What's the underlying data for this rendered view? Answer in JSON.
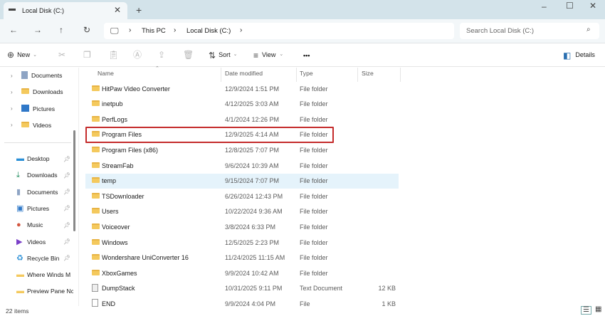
{
  "window": {
    "tab_title": "Local Disk (C:)"
  },
  "nav": {
    "breadcrumb": [
      "This PC",
      "Local Disk (C:)"
    ],
    "search_placeholder": "Search Local Disk (C:)"
  },
  "toolbar": {
    "new_label": "New",
    "sort_label": "Sort",
    "view_label": "View",
    "more_label": "•••",
    "details_label": "Details"
  },
  "sidebar": {
    "top": [
      {
        "label": "Documents",
        "icon": "documents-icon"
      },
      {
        "label": "Downloads",
        "icon": "folder-icon"
      },
      {
        "label": "Pictures",
        "icon": "pictures-icon"
      },
      {
        "label": "Videos",
        "icon": "folder-icon"
      }
    ],
    "quick": [
      {
        "label": "Desktop",
        "pinned": true
      },
      {
        "label": "Downloads",
        "pinned": true
      },
      {
        "label": "Documents",
        "pinned": true
      },
      {
        "label": "Pictures",
        "pinned": true
      },
      {
        "label": "Music",
        "pinned": true
      },
      {
        "label": "Videos",
        "pinned": true
      },
      {
        "label": "Recycle Bin",
        "pinned": true
      },
      {
        "label": "Where Winds M",
        "pinned": false
      },
      {
        "label": "Preview Pane Nc",
        "pinned": false
      }
    ]
  },
  "columns": {
    "name": "Name",
    "date": "Date modified",
    "type": "Type",
    "size": "Size"
  },
  "files": [
    {
      "name": "HitPaw Video Converter",
      "date": "12/9/2024 1:51 PM",
      "type": "File folder",
      "size": ""
    },
    {
      "name": "inetpub",
      "date": "4/12/2025 3:03 AM",
      "type": "File folder",
      "size": ""
    },
    {
      "name": "PerfLogs",
      "date": "4/1/2024 12:26 PM",
      "type": "File folder",
      "size": ""
    },
    {
      "name": "Program Files",
      "date": "12/9/2025 4:14 AM",
      "type": "File folder",
      "size": "",
      "highlighted": true
    },
    {
      "name": "Program Files (x86)",
      "date": "12/8/2025 7:07 PM",
      "type": "File folder",
      "size": ""
    },
    {
      "name": "StreamFab",
      "date": "9/6/2024 10:39 AM",
      "type": "File folder",
      "size": ""
    },
    {
      "name": "temp",
      "date": "9/15/2024 7:07 PM",
      "type": "File folder",
      "size": "",
      "hovered": true
    },
    {
      "name": "TSDownloader",
      "date": "6/26/2024 12:43 PM",
      "type": "File folder",
      "size": ""
    },
    {
      "name": "Users",
      "date": "10/22/2024 9:36 AM",
      "type": "File folder",
      "size": ""
    },
    {
      "name": "Voiceover",
      "date": "3/8/2024 6:33 PM",
      "type": "File folder",
      "size": ""
    },
    {
      "name": "Windows",
      "date": "12/5/2025 2:23 PM",
      "type": "File folder",
      "size": ""
    },
    {
      "name": "Wondershare UniConverter 16",
      "date": "11/24/2025 11:15 AM",
      "type": "File folder",
      "size": ""
    },
    {
      "name": "XboxGames",
      "date": "9/9/2024 10:42 AM",
      "type": "File folder",
      "size": ""
    },
    {
      "name": "DumpStack",
      "date": "10/31/2025 9:11 PM",
      "type": "Text Document",
      "size": "12 KB"
    },
    {
      "name": "END",
      "date": "9/9/2024 4:04 PM",
      "type": "File",
      "size": "1 KB"
    }
  ],
  "status": {
    "items": "22 items"
  },
  "colors": {
    "highlight_border": "#c42b2b",
    "hover_bg": "#e5f3fb",
    "folder": "#f4c95d"
  }
}
